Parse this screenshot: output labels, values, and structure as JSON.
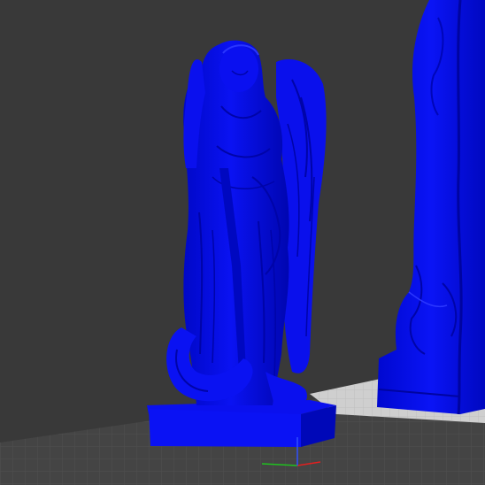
{
  "viewport": {
    "background_color": "#393939",
    "bed_color": "#474747",
    "grid_line_color": "#555555",
    "bed_highlight_color": "#d9d9d9",
    "model_color": "#0a10f0",
    "model_shadow_color": "#0000a8",
    "model_highlight_color": "#2a36ff"
  },
  "models": [
    {
      "name": "angel-statue",
      "label": ""
    },
    {
      "name": "tall-statue-cut",
      "label": ""
    }
  ],
  "axis_gizmo": {
    "x_color": "#e02020",
    "y_color": "#20c020",
    "z_color": "#3050ff"
  }
}
